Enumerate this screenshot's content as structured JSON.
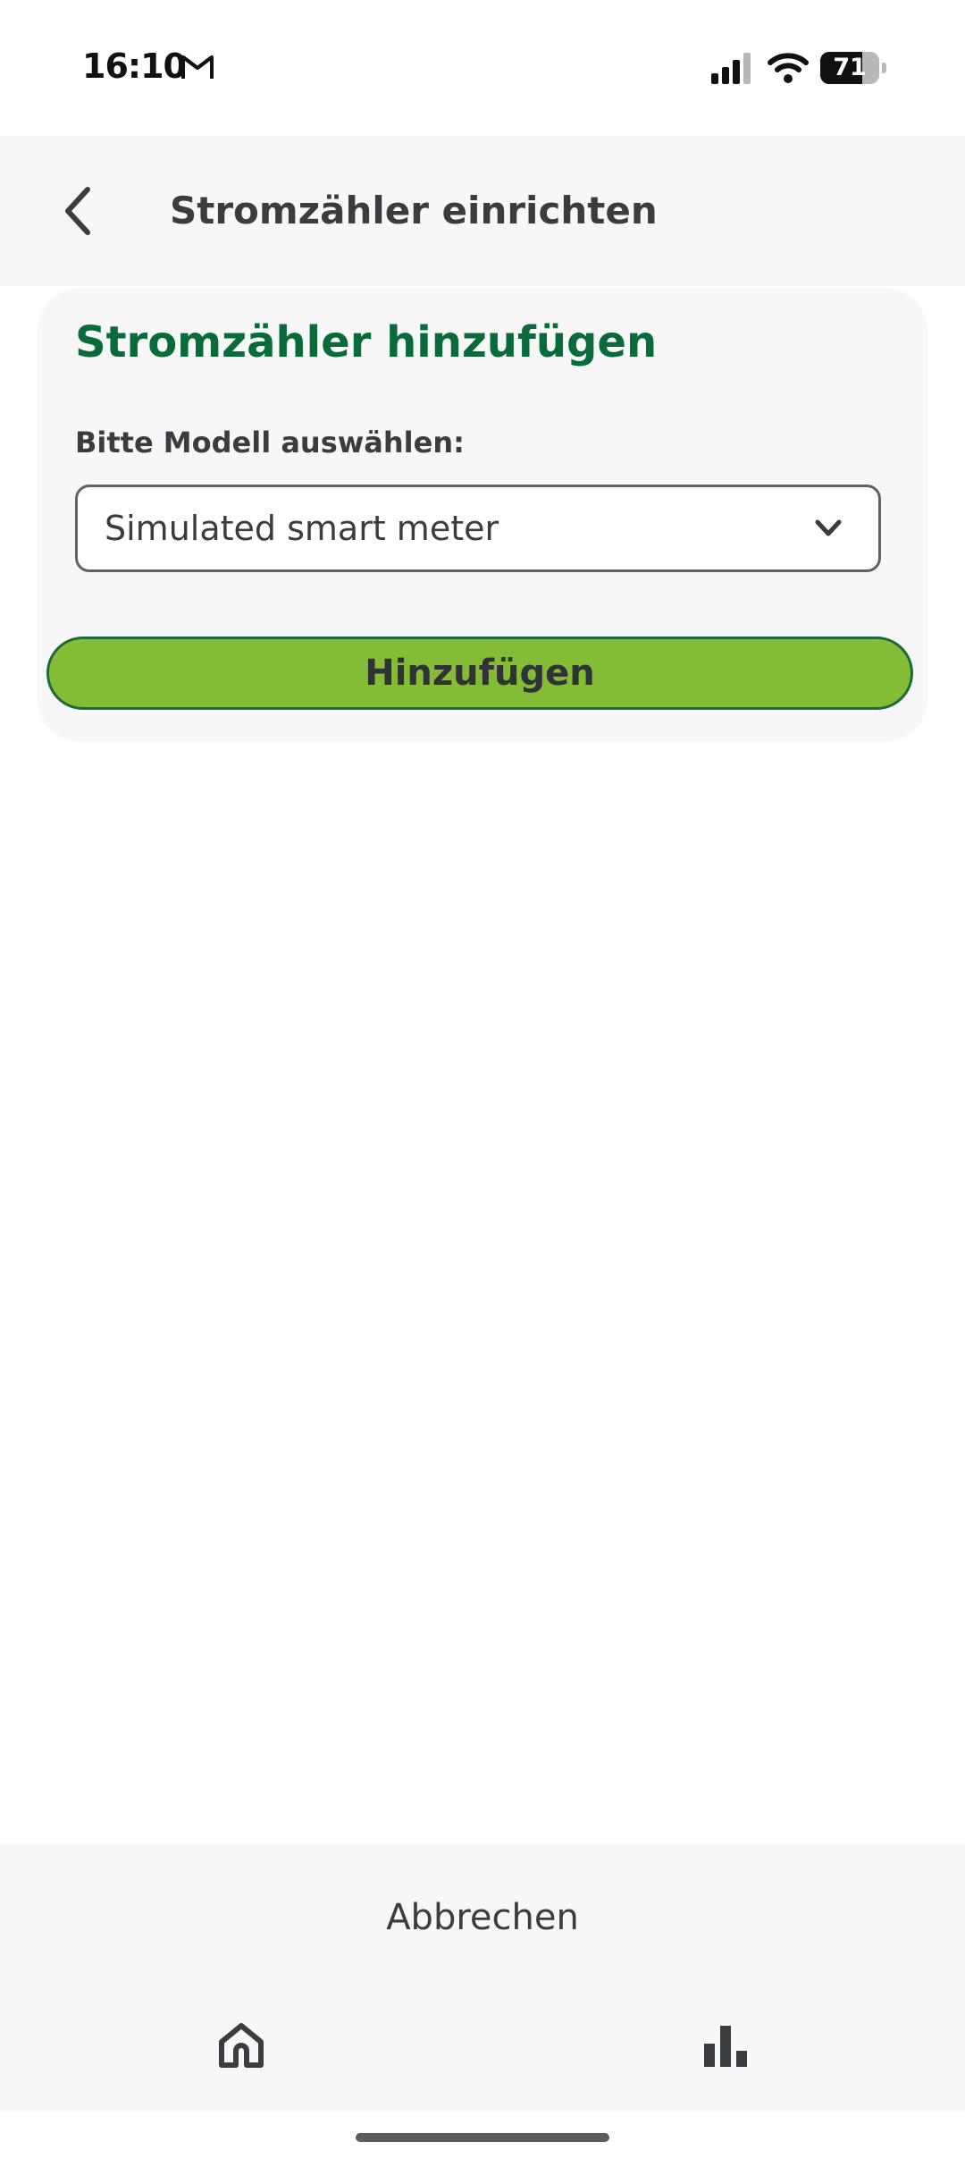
{
  "status_bar": {
    "time": "16:10",
    "battery_level": "71",
    "battery_fraction": 0.71,
    "icons": [
      "gmail-icon",
      "signal-icon",
      "wifi-icon",
      "battery-icon"
    ]
  },
  "header": {
    "title": "Stromzähler einrichten",
    "back_icon": "chevron-left-icon"
  },
  "card": {
    "title": "Stromzähler hinzufügen",
    "model_label": "Bitte Modell auswählen:",
    "model_selected": "Simulated smart meter",
    "add_button_label": "Hinzufügen"
  },
  "footer": {
    "cancel_label": "Abbrechen"
  },
  "bottom_nav": {
    "items": [
      {
        "icon": "home-icon"
      },
      {
        "icon": "bar-chart-icon"
      }
    ]
  },
  "colors": {
    "accent_green": "#84bc36",
    "title_green": "#0a6b3a",
    "surface": "#f7f7f7",
    "text": "#3a3d40"
  }
}
